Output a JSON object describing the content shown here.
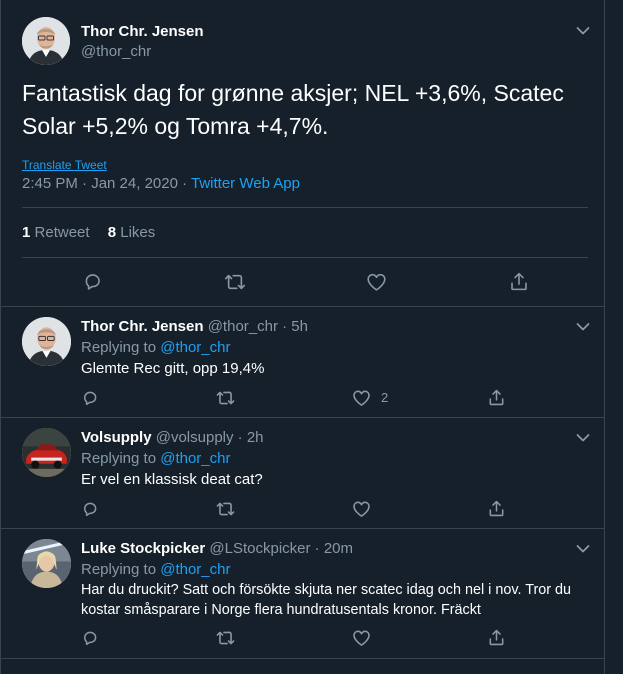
{
  "main_tweet": {
    "author_name": "Thor Chr. Jensen",
    "author_handle": "@thor_chr",
    "text": "Fantastisk dag for grønne aksjer; NEL +3,6%, Scatec Solar +5,2% og Tomra +4,7%.",
    "translate_label": "Translate Tweet",
    "timestamp": "2:45 PM · Jan 24, 2020 · ",
    "source_app": "Twitter Web App",
    "retweets_count": "1",
    "retweets_label": "Retweet",
    "likes_count": "8",
    "likes_label": "Likes"
  },
  "replies": [
    {
      "author_name": "Thor Chr. Jensen",
      "author_handle": "@thor_chr",
      "time": "· 5h",
      "replying_label": "Replying to",
      "replying_to": "@thor_chr",
      "text": "Glemte Rec gitt, opp 19,4%",
      "like_count": "2"
    },
    {
      "author_name": "Volsupply",
      "author_handle": "@volsupply",
      "time": "· 2h",
      "replying_label": "Replying to",
      "replying_to": "@thor_chr",
      "text": "Er vel en klassisk deat cat?",
      "like_count": ""
    },
    {
      "author_name": "Luke Stockpicker",
      "author_handle": "@LStockpicker",
      "time": "· 20m",
      "replying_label": "Replying to",
      "replying_to": "@thor_chr",
      "text": "Har du druckit? Satt och försökte skjuta ner scatec idag och nel i nov. Tror du kostar småsparare i Norge flera hundratusentals kronor. Fräckt",
      "like_count": ""
    }
  ],
  "colors": {
    "background": "#15202b",
    "border": "#38444d",
    "secondary_text": "#8899a6",
    "link": "#1da1f2"
  }
}
